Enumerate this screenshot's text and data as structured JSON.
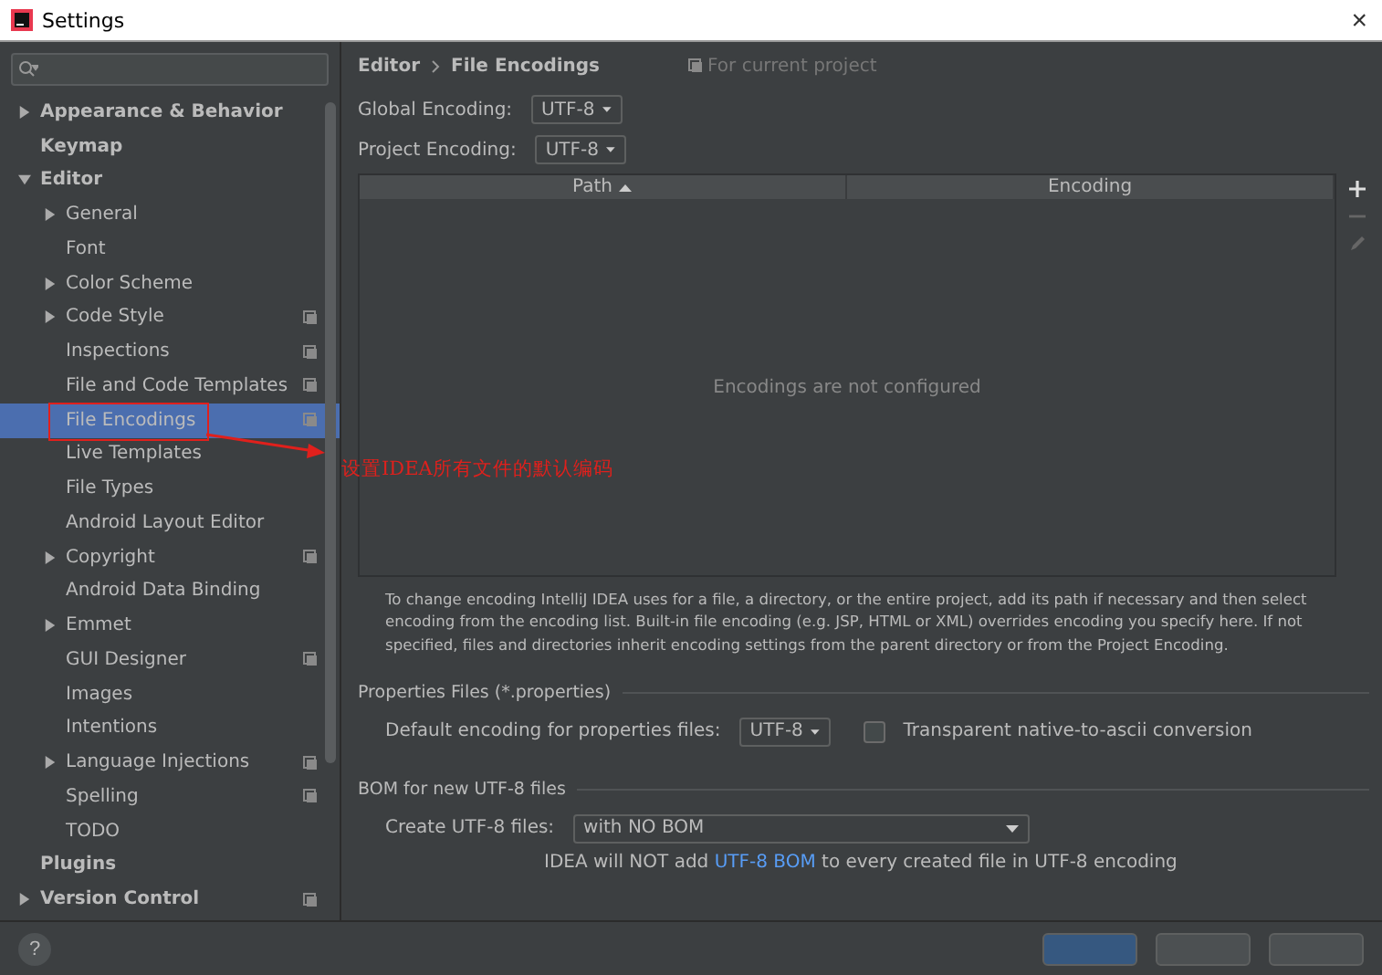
{
  "window": {
    "title": "Settings",
    "close": "×"
  },
  "sidebar": {
    "items": [
      {
        "label": "Appearance & Behavior",
        "expanded": false,
        "selected": false,
        "project_icon": false
      },
      {
        "label": "Keymap",
        "selected": false,
        "project_icon": false
      },
      {
        "label": "Editor",
        "expanded": true,
        "selected": false,
        "project_icon": false,
        "children": [
          {
            "label": "General",
            "expanded": false,
            "selected": false,
            "project_icon": false
          },
          {
            "label": "Font",
            "selected": false,
            "project_icon": false
          },
          {
            "label": "Color Scheme",
            "expanded": false,
            "selected": false,
            "project_icon": false
          },
          {
            "label": "Code Style",
            "expanded": false,
            "selected": false,
            "project_icon": true
          },
          {
            "label": "Inspections",
            "selected": false,
            "project_icon": true
          },
          {
            "label": "File and Code Templates",
            "selected": false,
            "project_icon": true
          },
          {
            "label": "File Encodings",
            "selected": true,
            "project_icon": true
          },
          {
            "label": "Live Templates",
            "selected": false,
            "project_icon": false
          },
          {
            "label": "File Types",
            "selected": false,
            "project_icon": false
          },
          {
            "label": "Android Layout Editor",
            "selected": false,
            "project_icon": false
          },
          {
            "label": "Copyright",
            "expanded": false,
            "selected": false,
            "project_icon": true
          },
          {
            "label": "Android Data Binding",
            "selected": false,
            "project_icon": false
          },
          {
            "label": "Emmet",
            "expanded": false,
            "selected": false,
            "project_icon": false
          },
          {
            "label": "GUI Designer",
            "selected": false,
            "project_icon": true
          },
          {
            "label": "Images",
            "selected": false,
            "project_icon": false
          },
          {
            "label": "Intentions",
            "selected": false,
            "project_icon": false
          },
          {
            "label": "Language Injections",
            "expanded": false,
            "selected": false,
            "project_icon": true
          },
          {
            "label": "Spelling",
            "selected": false,
            "project_icon": true
          },
          {
            "label": "TODO",
            "selected": false,
            "project_icon": false
          }
        ]
      },
      {
        "label": "Plugins",
        "selected": false,
        "project_icon": false
      },
      {
        "label": "Version Control",
        "expanded": false,
        "selected": false,
        "project_icon": true
      }
    ]
  },
  "breadcrumb": {
    "parent": "Editor",
    "current": "File Encodings",
    "scope": "For current project"
  },
  "encodings": [
    {
      "label": "Global Encoding:",
      "value": "UTF-8"
    },
    {
      "label": "Project Encoding:",
      "value": "UTF-8"
    }
  ],
  "table": {
    "columns": [
      {
        "label": "Path",
        "sorted": true
      },
      {
        "label": "Encoding",
        "sorted": false
      }
    ],
    "empty_text": "Encodings are not configured"
  },
  "description": "To change encoding IntelliJ IDEA uses for a file, a directory, or the entire project, add its path if necessary and then select encoding from the encoding list. Built-in file encoding (e.g. JSP, HTML or XML) overrides encoding you specify here. If not specified, files and directories inherit encoding settings from the parent directory or from the Project Encoding.",
  "properties": {
    "title": "Properties Files (*.properties)",
    "label": "Default encoding for properties files:",
    "value": "UTF-8",
    "checkbox": {
      "label": "Transparent native-to-ascii conversion",
      "checked": false
    }
  },
  "bom": {
    "title": "BOM for new UTF-8 files",
    "label": "Create UTF-8 files:",
    "value": "with NO BOM",
    "note_before": "IDEA will NOT add ",
    "note_link": "UTF-8 BOM",
    "note_after": " to every created file in UTF-8 encoding"
  },
  "footer": {
    "help": "?",
    "buttons": [
      {
        "default": true
      },
      {
        "default": false
      },
      {
        "default": false
      }
    ]
  },
  "annotation": {
    "text": "设置IDEA所有文件的默认编码"
  }
}
